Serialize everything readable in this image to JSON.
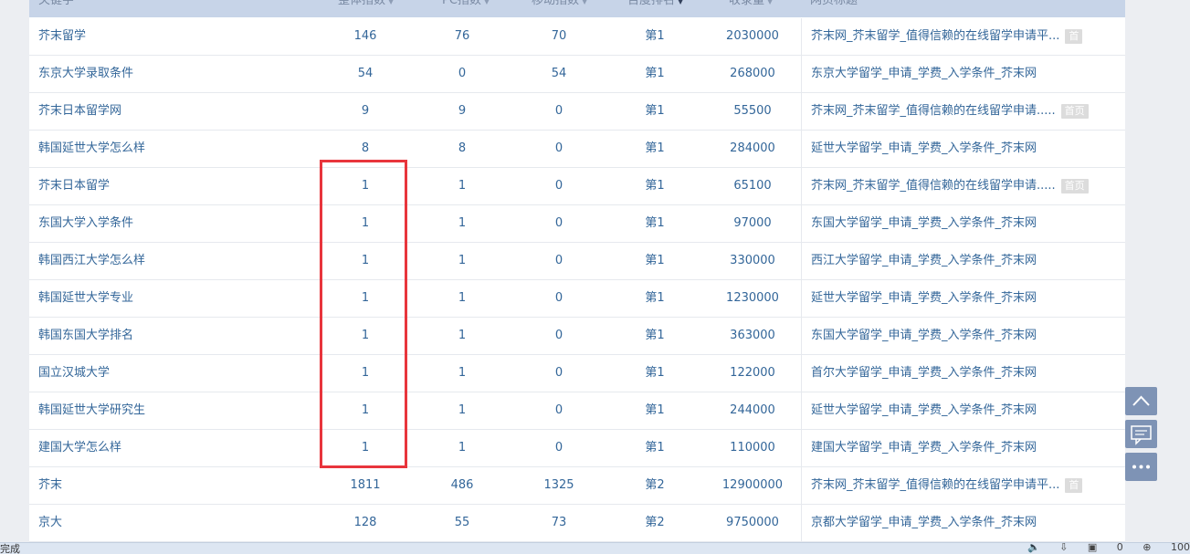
{
  "table": {
    "headers": {
      "keyword": "关键字",
      "total_index": "整体指数",
      "pc_index": "PC指数",
      "mobile_index": "移动指数",
      "baidu_rank": "百度排名",
      "indexed": "收录量",
      "page_title": "网页标题"
    },
    "rows": [
      {
        "keyword": "芥末留学",
        "total": "146",
        "pc": "76",
        "mobile": "70",
        "rank": "第1",
        "indexed": "2030000",
        "title": "芥末网_芥末留学_值得信赖的在线留学申请平...",
        "badge": "首"
      },
      {
        "keyword": "东京大学录取条件",
        "total": "54",
        "pc": "0",
        "mobile": "54",
        "rank": "第1",
        "indexed": "268000",
        "title": "东京大学留学_申请_学费_入学条件_芥末网",
        "badge": ""
      },
      {
        "keyword": "芥末日本留学网",
        "total": "9",
        "pc": "9",
        "mobile": "0",
        "rank": "第1",
        "indexed": "55500",
        "title": "芥末网_芥末留学_值得信赖的在线留学申请.....",
        "badge": "首页"
      },
      {
        "keyword": "韩国延世大学怎么样",
        "total": "8",
        "pc": "8",
        "mobile": "0",
        "rank": "第1",
        "indexed": "284000",
        "title": "延世大学留学_申请_学费_入学条件_芥末网",
        "badge": ""
      },
      {
        "keyword": "芥末日本留学",
        "total": "1",
        "pc": "1",
        "mobile": "0",
        "rank": "第1",
        "indexed": "65100",
        "title": "芥末网_芥末留学_值得信赖的在线留学申请.....",
        "badge": "首页"
      },
      {
        "keyword": "东国大学入学条件",
        "total": "1",
        "pc": "1",
        "mobile": "0",
        "rank": "第1",
        "indexed": "97000",
        "title": "东国大学留学_申请_学费_入学条件_芥末网",
        "badge": ""
      },
      {
        "keyword": "韩国西江大学怎么样",
        "total": "1",
        "pc": "1",
        "mobile": "0",
        "rank": "第1",
        "indexed": "330000",
        "title": "西江大学留学_申请_学费_入学条件_芥末网",
        "badge": ""
      },
      {
        "keyword": "韩国延世大学专业",
        "total": "1",
        "pc": "1",
        "mobile": "0",
        "rank": "第1",
        "indexed": "1230000",
        "title": "延世大学留学_申请_学费_入学条件_芥末网",
        "badge": ""
      },
      {
        "keyword": "韩国东国大学排名",
        "total": "1",
        "pc": "1",
        "mobile": "0",
        "rank": "第1",
        "indexed": "363000",
        "title": "东国大学留学_申请_学费_入学条件_芥末网",
        "badge": ""
      },
      {
        "keyword": "国立汉城大学",
        "total": "1",
        "pc": "1",
        "mobile": "0",
        "rank": "第1",
        "indexed": "122000",
        "title": "首尔大学留学_申请_学费_入学条件_芥末网",
        "badge": ""
      },
      {
        "keyword": "韩国延世大学研究生",
        "total": "1",
        "pc": "1",
        "mobile": "0",
        "rank": "第1",
        "indexed": "244000",
        "title": "延世大学留学_申请_学费_入学条件_芥末网",
        "badge": ""
      },
      {
        "keyword": "建国大学怎么样",
        "total": "1",
        "pc": "1",
        "mobile": "0",
        "rank": "第1",
        "indexed": "110000",
        "title": "建国大学留学_申请_学费_入学条件_芥末网",
        "badge": ""
      },
      {
        "keyword": "芥末",
        "total": "1811",
        "pc": "486",
        "mobile": "1325",
        "rank": "第2",
        "indexed": "12900000",
        "title": "芥末网_芥末留学_值得信赖的在线留学申请平...",
        "badge": "首"
      },
      {
        "keyword": "京大",
        "total": "128",
        "pc": "55",
        "mobile": "73",
        "rank": "第2",
        "indexed": "9750000",
        "title": "京都大学留学_申请_学费_入学条件_芥末网",
        "badge": ""
      }
    ]
  },
  "status_bar": {
    "left_text": "完成",
    "count_text": "0",
    "zoom_text": "100"
  },
  "colors": {
    "header_bg": "#c7d4e8",
    "link": "#336699",
    "highlight": "#e8353c",
    "float_button": "#7e93b5"
  }
}
